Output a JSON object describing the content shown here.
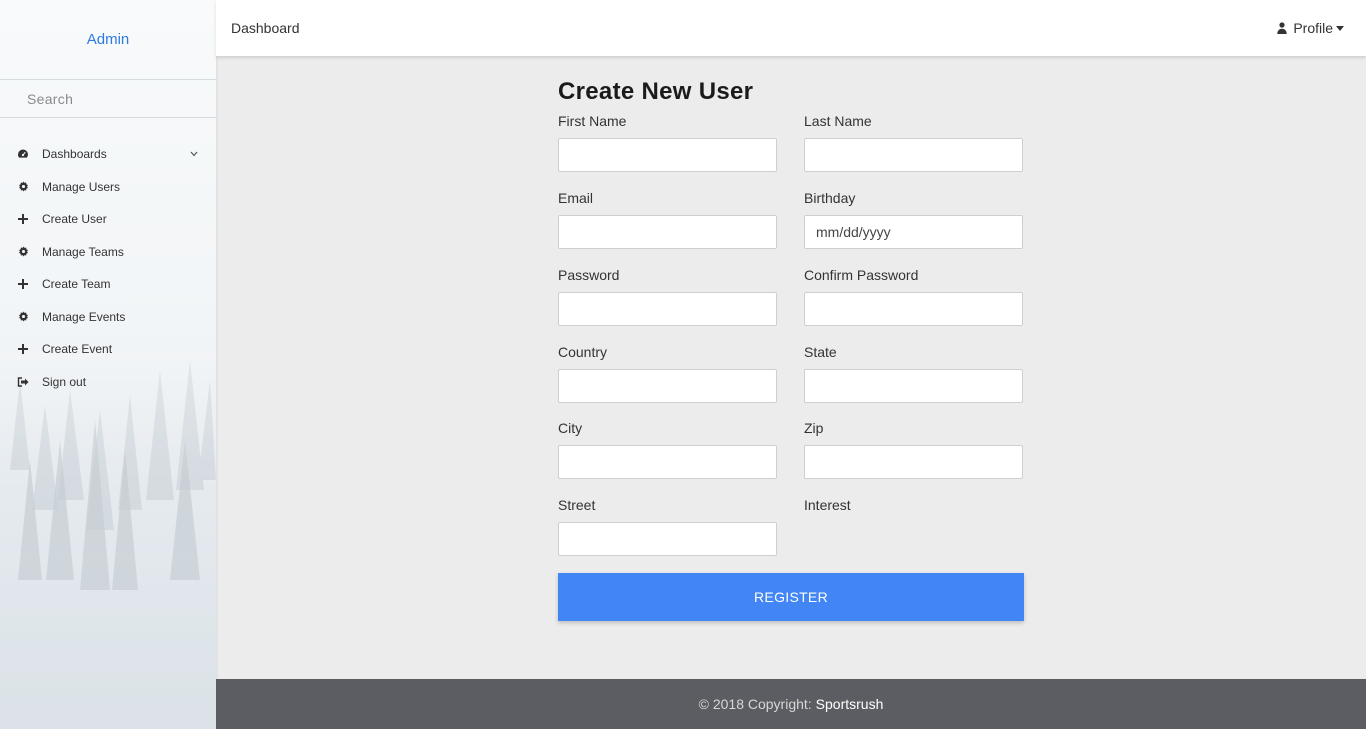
{
  "sidebar": {
    "brand": "Admin",
    "search_placeholder": "Search",
    "items": [
      {
        "label": "Dashboards",
        "icon": "dashboard-icon"
      },
      {
        "label": "Manage Users",
        "icon": "gear-icon"
      },
      {
        "label": "Create User",
        "icon": "plus-icon"
      },
      {
        "label": "Manage Teams",
        "icon": "gear-icon"
      },
      {
        "label": "Create Team",
        "icon": "plus-icon"
      },
      {
        "label": "Manage Events",
        "icon": "gear-icon"
      },
      {
        "label": "Create Event",
        "icon": "plus-icon"
      },
      {
        "label": "Sign out",
        "icon": "sign-out-icon"
      }
    ]
  },
  "topbar": {
    "title": "Dashboard",
    "profile_label": "Profile"
  },
  "form": {
    "title": "Create New User",
    "first_name_label": "First Name",
    "last_name_label": "Last Name",
    "email_label": "Email",
    "birthday_label": "Birthday",
    "birthday_placeholder": "mm/dd/yyyy",
    "password_label": "Password",
    "confirm_password_label": "Confirm Password",
    "country_label": "Country",
    "state_label": "State",
    "city_label": "City",
    "zip_label": "Zip",
    "street_label": "Street",
    "interest_label": "Interest",
    "register_label": "REGISTER"
  },
  "footer": {
    "copyright": "© 2018 Copyright:",
    "brand": "Sportsrush"
  },
  "colors": {
    "accent": "#4285f4",
    "brand_link": "#2c7be5",
    "footer_bg": "#5c5d62",
    "page_bg": "#ececec"
  }
}
